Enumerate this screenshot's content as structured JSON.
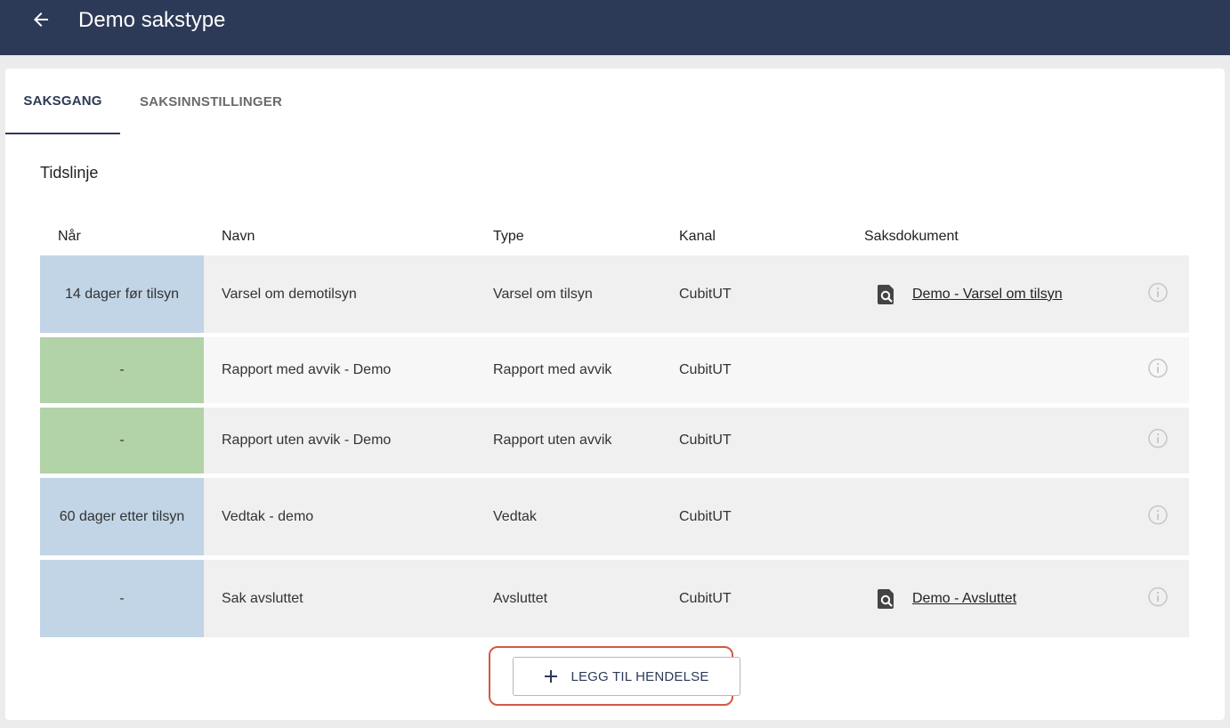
{
  "header": {
    "title": "Demo sakstype",
    "back_icon": "arrow-left-icon"
  },
  "tabs": [
    {
      "label": "SAKSGANG",
      "active": true
    },
    {
      "label": "SAKSINNSTILLINGER",
      "active": false
    }
  ],
  "timeline": {
    "title": "Tidslinje",
    "columns": [
      "Når",
      "Navn",
      "Type",
      "Kanal",
      "Saksdokument"
    ],
    "rows": [
      {
        "when": "14 dager før tilsyn",
        "when_color": "blue",
        "name": "Varsel om demotilsyn",
        "type": "Varsel om tilsyn",
        "channel": "CubitUT",
        "document": "Demo - Varsel om tilsyn"
      },
      {
        "when": "-",
        "when_color": "green",
        "name": "Rapport med avvik - Demo",
        "type": "Rapport med avvik",
        "channel": "CubitUT",
        "document": ""
      },
      {
        "when": "-",
        "when_color": "green",
        "name": "Rapport uten avvik - Demo",
        "type": "Rapport uten avvik",
        "channel": "CubitUT",
        "document": ""
      },
      {
        "when": "60 dager etter tilsyn",
        "when_color": "blue",
        "name": "Vedtak - demo",
        "type": "Vedtak",
        "channel": "CubitUT",
        "document": ""
      },
      {
        "when": "-",
        "when_color": "blue",
        "name": "Sak avsluttet",
        "type": "Avsluttet",
        "channel": "CubitUT",
        "document": "Demo - Avsluttet"
      }
    ]
  },
  "add_button": {
    "label": "LEGG TIL HENDELSE",
    "icon": "plus-icon"
  },
  "colors": {
    "header_bg": "#2d3a57",
    "when_blue": "#c1d5e7",
    "when_green": "#b2d2a7",
    "highlight": "#d05a45"
  }
}
